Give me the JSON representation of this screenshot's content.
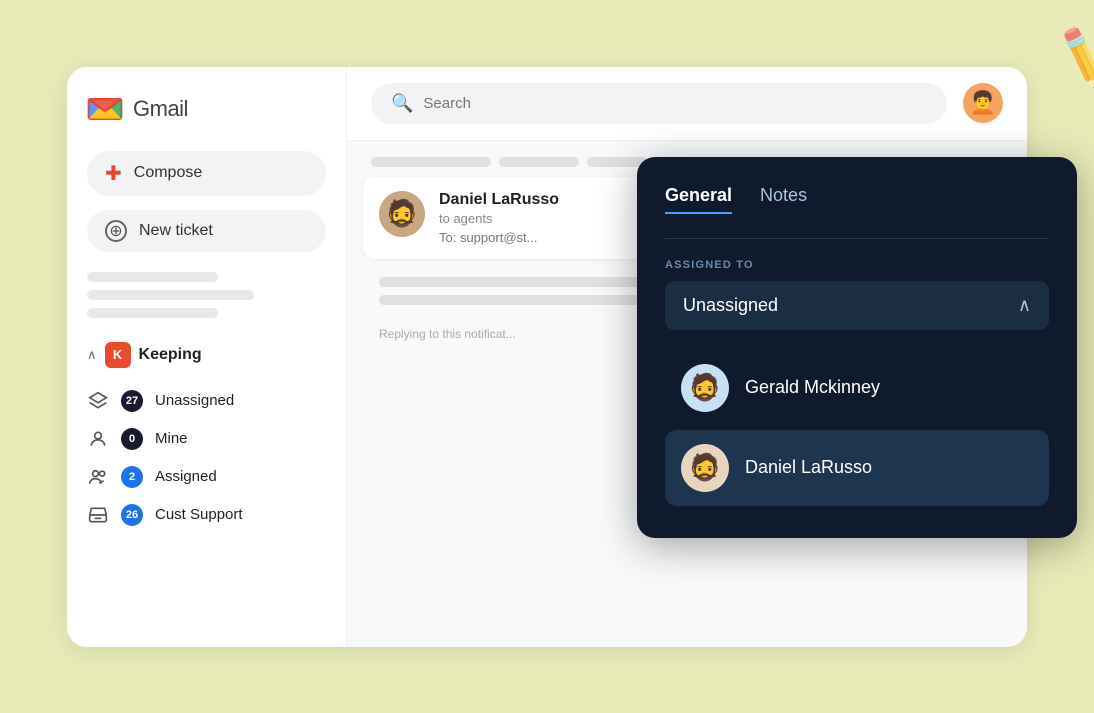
{
  "app": {
    "title": "Gmail"
  },
  "sidebar": {
    "gmail_m_label": "M",
    "gmail_text": "Gmail",
    "compose_label": "Compose",
    "new_ticket_label": "New ticket",
    "keeping_label": "Keeping",
    "nav_items": [
      {
        "icon": "layers",
        "badge": "27",
        "label": "Unassigned",
        "badge_variant": "dark"
      },
      {
        "icon": "person",
        "badge": "0",
        "label": "Mine",
        "badge_variant": "dark"
      },
      {
        "icon": "people",
        "badge": "2",
        "label": "Assigned",
        "badge_variant": "blue"
      },
      {
        "icon": "inbox",
        "badge": "26",
        "label": "Cust Support",
        "badge_variant": "blue"
      }
    ]
  },
  "topbar": {
    "search_placeholder": "Search"
  },
  "email": {
    "sender": "Daniel LaRusso",
    "subtext": "to agents",
    "to": "To: support@st...",
    "footer": "Replying to this notificat..."
  },
  "panel": {
    "tabs": [
      {
        "label": "General",
        "active": true
      },
      {
        "label": "Notes",
        "active": false
      }
    ],
    "assigned_to_label": "ASSIGNED TO",
    "assigned_value": "Unassigned",
    "agents": [
      {
        "name": "Gerald Mckinney",
        "selected": false
      },
      {
        "name": "Daniel LaRusso",
        "selected": true
      }
    ]
  }
}
